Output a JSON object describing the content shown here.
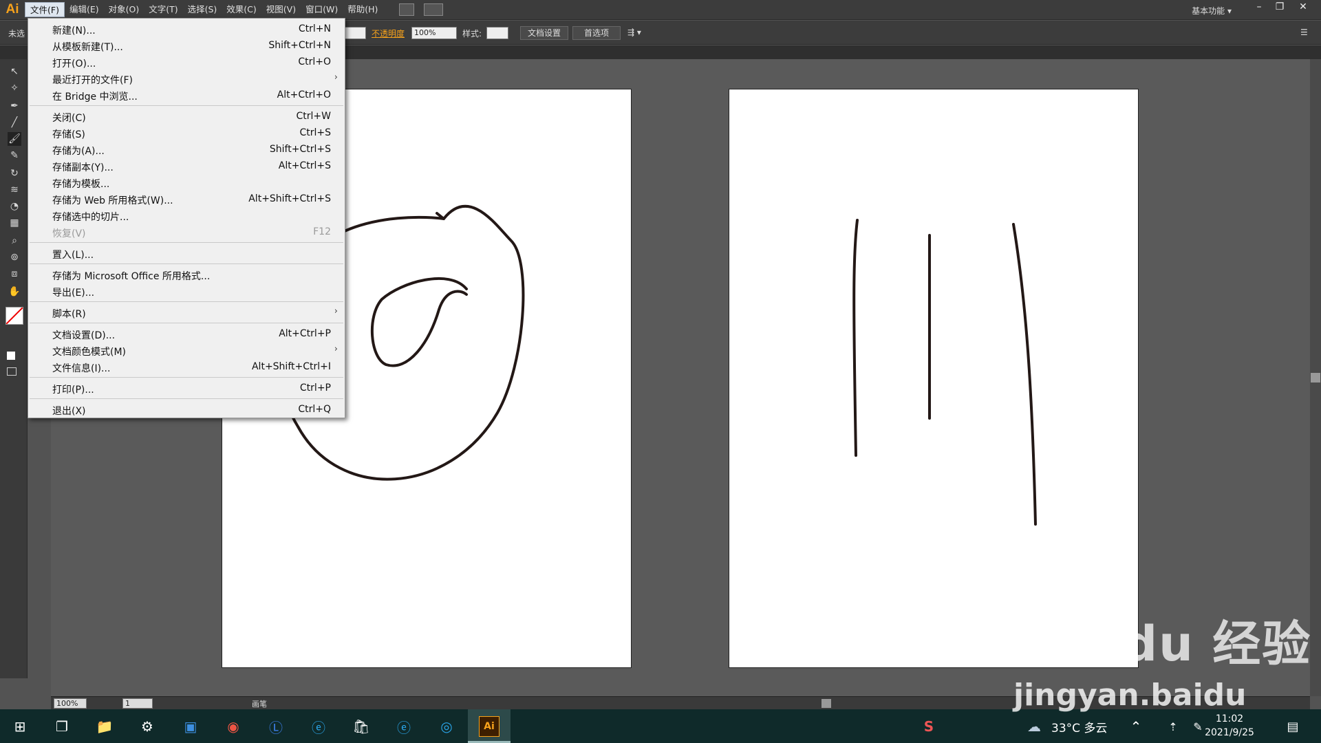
{
  "menubar": {
    "logo": "Ai",
    "items": [
      "文件(F)",
      "编辑(E)",
      "对象(O)",
      "文字(T)",
      "选择(S)",
      "效果(C)",
      "视图(V)",
      "窗口(W)",
      "帮助(H)"
    ],
    "workspace": "基本功能",
    "win_min": "–",
    "win_restore": "❐",
    "win_close": "✕"
  },
  "controlbar": {
    "left_text": "未选",
    "opacity_label": "不透明度",
    "opacity_value": "100%",
    "style_label": "样式:",
    "doc_setup": "文档设置",
    "prefs": "首选项"
  },
  "statusbar": {
    "zoom": "100%",
    "page": "1",
    "tool_name": "画笔"
  },
  "file_menu": [
    {
      "label": "新建(N)...",
      "shortcut": "Ctrl+N"
    },
    {
      "label": "从模板新建(T)...",
      "shortcut": "Shift+Ctrl+N"
    },
    {
      "label": "打开(O)...",
      "shortcut": "Ctrl+O"
    },
    {
      "label": "最近打开的文件(F)",
      "shortcut": "",
      "submenu": true
    },
    {
      "label": "在 Bridge 中浏览...",
      "shortcut": "Alt+Ctrl+O"
    },
    {
      "sep": true
    },
    {
      "label": "关闭(C)",
      "shortcut": "Ctrl+W"
    },
    {
      "label": "存储(S)",
      "shortcut": "Ctrl+S"
    },
    {
      "label": "存储为(A)...",
      "shortcut": "Shift+Ctrl+S"
    },
    {
      "label": "存储副本(Y)...",
      "shortcut": "Alt+Ctrl+S"
    },
    {
      "label": "存储为模板...",
      "shortcut": ""
    },
    {
      "label": "存储为 Web 所用格式(W)...",
      "shortcut": "Alt+Shift+Ctrl+S"
    },
    {
      "label": "存储选中的切片...",
      "shortcut": ""
    },
    {
      "label": "恢复(V)",
      "shortcut": "F12",
      "disabled": true
    },
    {
      "sep": true
    },
    {
      "label": "置入(L)...",
      "shortcut": ""
    },
    {
      "sep": true
    },
    {
      "label": "存储为 Microsoft Office 所用格式...",
      "shortcut": ""
    },
    {
      "label": "导出(E)...",
      "shortcut": ""
    },
    {
      "sep": true
    },
    {
      "label": "脚本(R)",
      "shortcut": "",
      "submenu": true
    },
    {
      "sep": true
    },
    {
      "label": "文档设置(D)...",
      "shortcut": "Alt+Ctrl+P"
    },
    {
      "label": "文档颜色模式(M)",
      "shortcut": "",
      "submenu": true
    },
    {
      "label": "文件信息(I)...",
      "shortcut": "Alt+Shift+Ctrl+I"
    },
    {
      "sep": true
    },
    {
      "label": "打印(P)...",
      "shortcut": "Ctrl+P"
    },
    {
      "sep": true
    },
    {
      "label": "退出(X)",
      "shortcut": "Ctrl+Q"
    }
  ],
  "taskbar": {
    "weather": "33°C 多云",
    "time": "11:02",
    "date": "2021/9/25"
  },
  "watermark": {
    "line1": "Bai du 经验",
    "line2": "jingyan.baidu"
  }
}
